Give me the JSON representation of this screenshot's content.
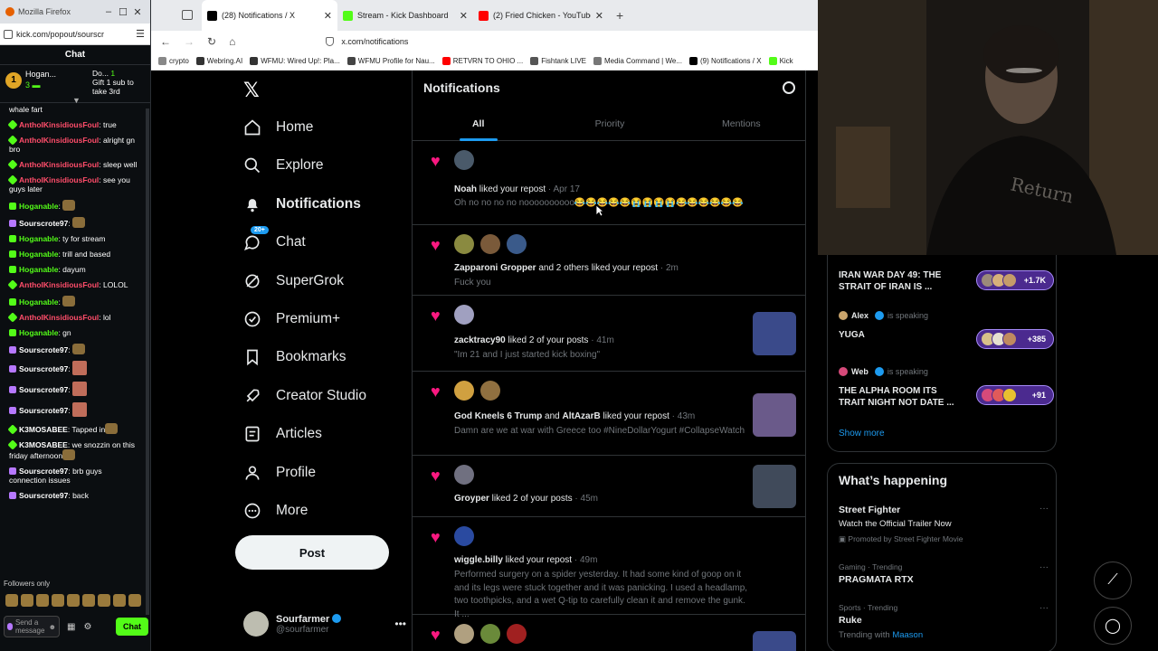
{
  "chatwin": {
    "win_title": "Mozilla Firefox",
    "url": "kick.com/popout/sourscr",
    "header": "Chat",
    "pinned_rank": "1",
    "pinned_user": "Hogan...",
    "pinned_count": "3",
    "pinned_user2": "Do...",
    "pinned_rank2": "1",
    "pinned_gift": "Gift 1 sub to take 3rd",
    "messages": [
      {
        "user": "",
        "color": "white",
        "badge": "",
        "text": "whale fart"
      },
      {
        "user": "AnthoIKinsidiousFoul",
        "color": "red",
        "badge": "b-star",
        "text": ": true"
      },
      {
        "user": "AnthoIKinsidiousFoul",
        "color": "red",
        "badge": "b-star",
        "text": ": alright gn bro"
      },
      {
        "user": "AnthoIKinsidiousFoul",
        "color": "red",
        "badge": "b-star",
        "text": ": sleep well"
      },
      {
        "user": "AnthoIKinsidiousFoul",
        "color": "red",
        "badge": "b-star",
        "text": ": see you guys later"
      },
      {
        "user": "Hoganable",
        "color": "green",
        "badge": "b-sq",
        "text": ": "
      },
      {
        "user": "Sourscrote97",
        "color": "white",
        "badge": "b-mic",
        "text": ": "
      },
      {
        "user": "Hoganable",
        "color": "green",
        "badge": "b-sq",
        "text": ": ty for stream"
      },
      {
        "user": "Hoganable",
        "color": "green",
        "badge": "b-sq",
        "text": ": trill and based"
      },
      {
        "user": "Hoganable",
        "color": "green",
        "badge": "b-sq",
        "text": ": dayum"
      },
      {
        "user": "AnthoIKinsidiousFoul",
        "color": "red",
        "badge": "b-star",
        "text": ": LOLOL"
      },
      {
        "user": "Hoganable",
        "color": "green",
        "badge": "b-sq",
        "text": ": "
      },
      {
        "user": "AnthoIKinsidiousFoul",
        "color": "red",
        "badge": "b-star",
        "text": ": lol"
      },
      {
        "user": "Hoganable",
        "color": "green",
        "badge": "b-sq",
        "text": ": gn"
      },
      {
        "user": "Sourscrote97",
        "color": "white",
        "badge": "b-mic",
        "text": ": "
      },
      {
        "user": "Sourscrote97",
        "color": "white",
        "badge": "b-mic",
        "text": ": "
      },
      {
        "user": "Sourscrote97",
        "color": "white",
        "badge": "b-mic",
        "text": ": "
      },
      {
        "user": "Sourscrote97",
        "color": "white",
        "badge": "b-mic",
        "text": ": "
      },
      {
        "user": "K3MOSABEE",
        "color": "white",
        "badge": "b-star",
        "text": ": Tapped in"
      },
      {
        "user": "K3MOSABEE",
        "color": "white",
        "badge": "b-star",
        "text": ": we snozzin on this friday afternoon"
      },
      {
        "user": "Sourscrote97",
        "color": "white",
        "badge": "b-mic",
        "text": ": brb guys connection issues"
      },
      {
        "user": "Sourscrote97",
        "color": "white",
        "badge": "b-mic",
        "text": ": back"
      }
    ],
    "followers_only": "Followers only",
    "send_placeholder": "Send a message",
    "chat_button": "Chat"
  },
  "browser": {
    "tabs": [
      {
        "label": "(28) Notifications / X",
        "icon_color": "#000000"
      },
      {
        "label": "Stream - Kick Dashboard",
        "icon_color": "#53fc18"
      },
      {
        "label": "(2) Fried Chicken - YouTube",
        "icon_color": "#ff0000"
      }
    ],
    "address": "x.com/notifications",
    "bookmarks": [
      {
        "label": "crypto",
        "color": "#888888"
      },
      {
        "label": "Webring.AI",
        "color": "#333333"
      },
      {
        "label": "WFMU: Wired Up!: Pla...",
        "color": "#333333"
      },
      {
        "label": "WFMU Profile for Nau...",
        "color": "#444444"
      },
      {
        "label": "RETVRN TO OHIO ...",
        "color": "#ff0000"
      },
      {
        "label": "Fishtank LIVE",
        "color": "#555555"
      },
      {
        "label": "Media Command | We...",
        "color": "#777777"
      },
      {
        "label": "(9) Notifications / X",
        "color": "#000000"
      },
      {
        "label": "Kick",
        "color": "#53fc18"
      }
    ]
  },
  "xnav": {
    "items": [
      {
        "label": "Home",
        "icon": "home-icon"
      },
      {
        "label": "Explore",
        "icon": "search-icon"
      },
      {
        "label": "Notifications",
        "icon": "bell-icon"
      },
      {
        "label": "Chat",
        "icon": "chat-icon"
      },
      {
        "label": "SuperGrok",
        "icon": "grok-icon"
      },
      {
        "label": "Premium+",
        "icon": "verified-icon"
      },
      {
        "label": "Bookmarks",
        "icon": "bookmark-icon"
      },
      {
        "label": "Creator Studio",
        "icon": "rocket-icon"
      },
      {
        "label": "Articles",
        "icon": "article-icon"
      },
      {
        "label": "Profile",
        "icon": "profile-icon"
      },
      {
        "label": "More",
        "icon": "more-icon"
      }
    ],
    "chat_badge": "20+",
    "post_label": "Post",
    "account_name": "Sourfarmer",
    "account_handle": "@sourfarmer"
  },
  "xmain": {
    "title": "Notifications",
    "tabs": [
      "All",
      "Priority",
      "Mentions"
    ],
    "notifications": [
      {
        "who": "Noah",
        "action": " liked your repost",
        "time": " · Apr 17",
        "sub": "Oh no no no no noooooooooo😂😂😂😂😂😭😭😭😭😂😂😂😂😂😂"
      },
      {
        "who": "Zapparoni Gropper",
        "action": " and 2 others liked your repost",
        "time": " · 2m",
        "sub": "Fuck you"
      },
      {
        "who": "zacktracy90",
        "action": " liked 2 of your posts",
        "time": " · 41m",
        "sub": "\"Im 21 and I just started kick boxing\""
      },
      {
        "who": "God Kneels 6 Trump",
        "action": " and ",
        "who2": "AltAzarB",
        "action2": " liked your repost",
        "time": " · 43m",
        "sub": "Damn are we at war with Greece too #NineDollarYogurt #CollapseWatch"
      },
      {
        "who": "Groyper",
        "action": " liked 2 of your posts",
        "time": " · 45m",
        "sub": ""
      },
      {
        "who": "wiggle.billy",
        "action": " liked your repost",
        "time": " · 49m",
        "sub": "Performed surgery on a spider yesterday. It had some kind of goop on it and its legs were stuck together and it was panicking. I used a headlamp, two toothpicks, and a wet Q-tip to carefully clean it and remove the gunk. It ..."
      }
    ]
  },
  "xright": {
    "spaces": [
      {
        "title": "IRAN WAR DAY 49: THE STRAIT OF IRAN IS ...",
        "count": "+1.7K",
        "host": "",
        "status": ""
      },
      {
        "title": "YUGA",
        "count": "+385",
        "host": "Alex",
        "status": "is speaking"
      },
      {
        "title": "THE ALPHA ROOM ITS TRAIT NIGHT NOT DATE ...",
        "count": "+91",
        "host": "Web",
        "status": "is speaking"
      }
    ],
    "show_more": "Show more",
    "happening_title": "What’s happening",
    "trends": [
      {
        "meta": "",
        "name": "Street Fighter",
        "sub": "Watch the Official Trailer Now",
        "promo": "Promoted by Street Fighter Movie"
      },
      {
        "meta": "Gaming · Trending",
        "name": "PRAGMATA RTX",
        "sub": "",
        "promo": ""
      },
      {
        "meta": "Sports · Trending",
        "name": "Ruke",
        "sub": "Trending with ",
        "link": "Maason"
      }
    ]
  },
  "colors": {
    "accent": "#1d9bf0",
    "like": "#f91880",
    "kick": "#53fc18"
  }
}
